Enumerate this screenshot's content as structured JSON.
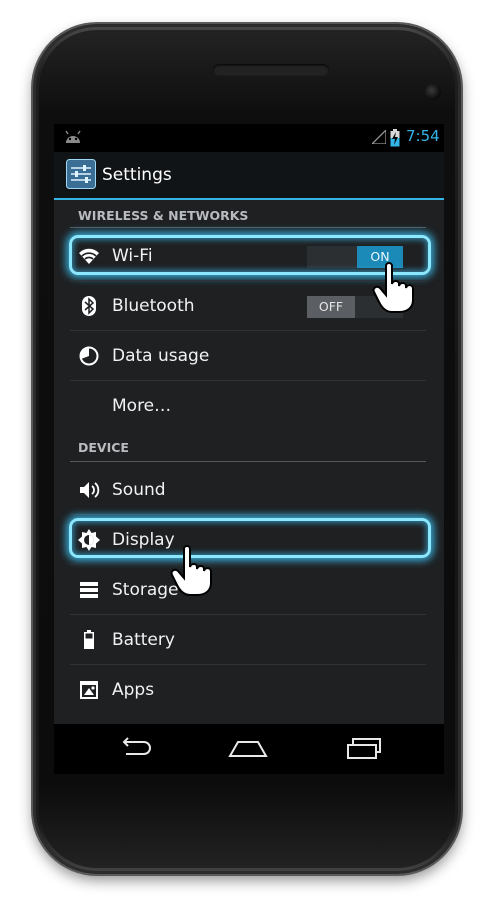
{
  "statusbar": {
    "time": "7:54"
  },
  "actionbar": {
    "title": "Settings"
  },
  "sections": {
    "wireless": "WIRELESS & NETWORKS",
    "device": "DEVICE"
  },
  "items": {
    "wifi": {
      "label": "Wi-Fi",
      "toggle": "ON"
    },
    "bluetooth": {
      "label": "Bluetooth",
      "toggle": "OFF"
    },
    "data_usage": {
      "label": "Data usage"
    },
    "more": {
      "label": "More…"
    },
    "sound": {
      "label": "Sound"
    },
    "display": {
      "label": "Display"
    },
    "storage": {
      "label": "Storage"
    },
    "battery": {
      "label": "Battery"
    },
    "apps": {
      "label": "Apps"
    }
  },
  "icons": {
    "statusbar": [
      "android-icon",
      "signal-icon",
      "battery-charging-icon"
    ],
    "rows": [
      "wifi-icon",
      "bluetooth-icon",
      "data-usage-icon",
      "sound-icon",
      "display-icon",
      "storage-icon",
      "battery-icon",
      "apps-icon"
    ],
    "nav": [
      "back-icon",
      "home-icon",
      "recent-apps-icon"
    ],
    "overlay": [
      "pointing-hand-icon"
    ]
  },
  "colors": {
    "accent": "#33b5e5",
    "toggle_on": "#1c8ab8",
    "highlight_glow": "#8ce8ff",
    "background": "#1e2022"
  }
}
